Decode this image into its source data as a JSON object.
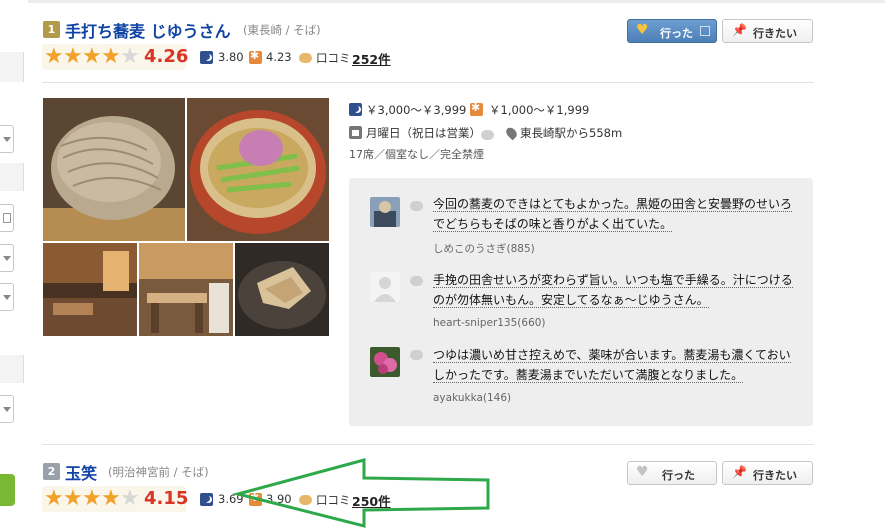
{
  "colors": {
    "link_blue": "#0f44a4",
    "score_red": "#d93425",
    "star_orange": "#f2a12b",
    "went_button_blue": "#5587c0",
    "arrow_green": "#2fa84a",
    "panel_gray": "#eeeeee"
  },
  "restaurants": [
    {
      "rank": "1",
      "name": "手打ち蕎麦 じゆうさん",
      "area": "(東長崎 / そば)",
      "rating": 4.26,
      "rating_text": "4.26",
      "stars_filled": 4,
      "dinner_score": "3.80",
      "lunch_score": "4.23",
      "reviews_label": "口コミ",
      "reviews_count": "252件",
      "went_label": "行った",
      "want_label": "行きたい",
      "went_active": true,
      "dinner_budget": "￥3,000～￥3,999",
      "lunch_budget": "￥1,000～￥1,999",
      "holiday": "月曜日（祝日は営業）",
      "station": "東長崎駅から558m",
      "seats": "17席／個室なし／完全禁煙",
      "reviews": [
        {
          "avatar_icon": "user-photo-icon",
          "text_line1": "今回の蕎麦のできはとてもよかった。黒姫の田舎と安曇野のせいろ",
          "text_line2": "でどちらもそばの味と香りがよく出ていた。",
          "user": "しめこのうさぎ(885)"
        },
        {
          "avatar_icon": "default-user-icon",
          "text_line1": "手挽の田舎せいろが変わらず旨い。いつも塩で手繰る。汁につける",
          "text_line2": "のが勿体無いもん。安定してるなぁ～じゆうさん。",
          "user": "heart-sniper135(660)"
        },
        {
          "avatar_icon": "flower-photo-icon",
          "text_line1": "つゆは濃いめ甘さ控えめで、薬味が合います。蕎麦湯も濃くておい",
          "text_line2": "しかったです。蕎麦湯までいただいて満腹となりました。",
          "user": "ayakukka(146)"
        }
      ]
    },
    {
      "rank": "2",
      "name": "玉笑",
      "area": "(明治神宮前 / そば)",
      "rating": 4.15,
      "rating_text": "4.15",
      "stars_filled": 4,
      "dinner_score": "3.69",
      "lunch_score": "3.90",
      "reviews_label": "口コミ",
      "reviews_count": "250件",
      "went_label": "行った",
      "want_label": "行きたい",
      "went_active": false
    }
  ]
}
